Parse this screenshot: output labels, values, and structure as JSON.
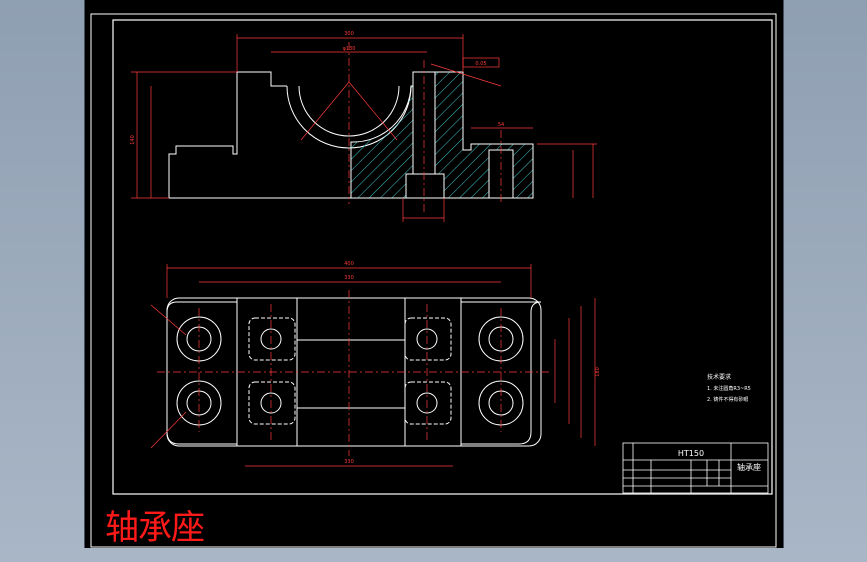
{
  "caption": "轴承座",
  "colors": {
    "background": "#000000",
    "outline": "#ffffff",
    "dimension": "#ff3b3b",
    "hatch": "#3ec7c7",
    "center": "#ff3b3b"
  },
  "title_block": {
    "material": "HT150",
    "part_name": "轴承座"
  },
  "tech_notes": {
    "title": "技术要求",
    "line1": "1. 未注圆角R3~R5",
    "line2": "2. 铸件不得有砂眼"
  },
  "front_view_dims": {
    "overall_width": "300",
    "bore_dia": "φ130",
    "flatness": "0.05",
    "height": "140",
    "flange_width": "54"
  },
  "top_view_dims": {
    "overall_length": "400",
    "inner_length": "330",
    "bottom_length": "330",
    "side_height": "180"
  }
}
